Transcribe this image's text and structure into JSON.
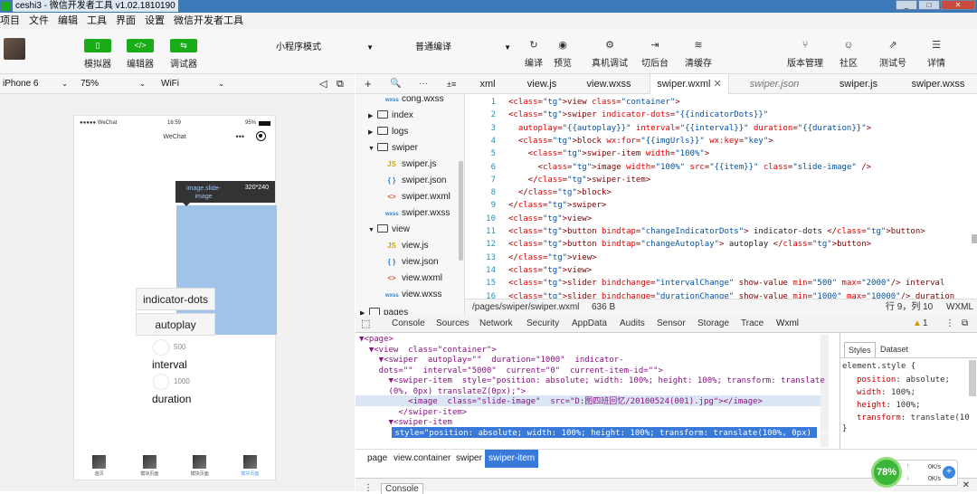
{
  "window": {
    "title": "ceshi3 - 微信开发者工具 v1.02.1810190",
    "buttons": [
      "_",
      "□",
      "✕"
    ]
  },
  "menu": [
    "项目",
    "文件",
    "编辑",
    "工具",
    "界面",
    "设置",
    "微信开发者工具"
  ],
  "toolbar": {
    "left": [
      {
        "label": "模拟器",
        "glyph": "▯"
      },
      {
        "label": "编辑器",
        "glyph": "</>"
      },
      {
        "label": "调试器",
        "glyph": "⇆"
      }
    ],
    "mode_select": "小程序模式",
    "compile_select": "普通编译",
    "mid": [
      {
        "label": "编译",
        "glyph": "↻"
      },
      {
        "label": "预览",
        "glyph": "◉"
      },
      {
        "label": "真机调试",
        "glyph": "⚙"
      },
      {
        "label": "切后台",
        "glyph": "⇥"
      },
      {
        "label": "清缓存",
        "glyph": "≋"
      }
    ],
    "right": [
      {
        "label": "版本管理",
        "glyph": "⑂"
      },
      {
        "label": "社区",
        "glyph": "☺"
      },
      {
        "label": "测试号",
        "glyph": "⇗"
      },
      {
        "label": "详情",
        "glyph": "☰"
      }
    ]
  },
  "device_bar": {
    "device": "iPhone 6",
    "zoom": "75%",
    "network": "WiFi"
  },
  "phone": {
    "status_left": "●●●●● WeChat",
    "time": "16:59",
    "battery": "95%",
    "nav_title": "WeChat",
    "nav_dots": "•••",
    "tooltip_name": "image.slide-image",
    "tooltip_dim": "320*240",
    "btn_indicator": "indicator-dots",
    "btn_autoplay": "autoplay",
    "slider1_value": "500",
    "slider1_label": "interval",
    "slider2_value": "1000",
    "slider2_label": "duration",
    "tabs": [
      {
        "label": "首页",
        "active": false
      },
      {
        "label": "模块页面",
        "active": false
      },
      {
        "label": "模块页面",
        "active": false
      },
      {
        "label": "模块页面",
        "active": true
      }
    ]
  },
  "tree": {
    "toolbar": [
      "+",
      "🔍",
      "···",
      "±≡"
    ],
    "items": [
      {
        "label": "cong.wxss",
        "type": "wxss",
        "depth": 2
      },
      {
        "label": "index",
        "type": "folder",
        "depth": 1,
        "open": false
      },
      {
        "label": "logs",
        "type": "folder",
        "depth": 1,
        "open": false
      },
      {
        "label": "swiper",
        "type": "folder",
        "depth": 1,
        "open": true
      },
      {
        "label": "swiper.js",
        "type": "js",
        "depth": 2
      },
      {
        "label": "swiper.json",
        "type": "json",
        "depth": 2
      },
      {
        "label": "swiper.wxml",
        "type": "wxml",
        "depth": 2,
        "selected": true
      },
      {
        "label": "swiper.wxss",
        "type": "wxss",
        "depth": 2
      },
      {
        "label": "view",
        "type": "folder",
        "depth": 1,
        "open": true
      },
      {
        "label": "view.js",
        "type": "js",
        "depth": 2
      },
      {
        "label": "view.json",
        "type": "json",
        "depth": 2
      },
      {
        "label": "view.wxml",
        "type": "wxml",
        "depth": 2
      },
      {
        "label": "view.wxss",
        "type": "wxss",
        "depth": 2
      },
      {
        "label": "pages",
        "type": "folder",
        "depth": 0,
        "open": false
      }
    ]
  },
  "editor_tabs": [
    {
      "label": "xml",
      "active": false,
      "italic": false
    },
    {
      "label": "view.js",
      "active": false,
      "italic": false
    },
    {
      "label": "view.wxss",
      "active": false,
      "italic": false
    },
    {
      "label": "swiper.wxml",
      "active": true,
      "italic": false
    },
    {
      "label": "swiper.json",
      "active": false,
      "italic": true
    },
    {
      "label": "swiper.js",
      "active": false,
      "italic": false
    },
    {
      "label": "swiper.wxss",
      "active": false,
      "italic": false
    }
  ],
  "code": [
    "<view class=\"container\">",
    "<swiper indicator-dots=\"{{indicatorDots}}\"",
    "  autoplay=\"{{autoplay}}\" interval=\"{{interval}}\" duration=\"{{duration}}\">",
    "  <block wx:for=\"{{imgUrls}}\" wx:key=\"key\">",
    "    <swiper-item width=\"100%\">",
    "      <image width=\"100%\" src=\"{{item}}\" class=\"slide-image\" />",
    "    </swiper-item>",
    "  </block>",
    "</swiper>",
    "<view>",
    "<button bindtap=\"changeIndicatorDots\"> indicator-dots </button>",
    "<button bindtap=\"changeAutoplay\"> autoplay </button>",
    "</view>",
    "<view>",
    "<slider bindchange=\"intervalChange\" show-value min=\"500\" max=\"2000\"/> interval",
    "<slider bindchange=\"durationChange\" show-value min=\"1000\" max=\"10000\"/> duration"
  ],
  "editor_status": {
    "path": "/pages/swiper/swiper.wxml",
    "size": "636 B",
    "position": "行 9，列 10",
    "lang": "WXML"
  },
  "devtools_tabs": [
    "Console",
    "Sources",
    "Network",
    "Security",
    "AppData",
    "Audits",
    "Sensor",
    "Storage",
    "Trace",
    "Wxml"
  ],
  "devtools_active": "Wxml",
  "warn_count": "1",
  "dom_lines": [
    "▼<page>",
    "  ▼<view  class=\"container\">",
    "    ▼<swiper  autoplay=\"\"  duration=\"1000\"  indicator-",
    "    dots=\"\"  interval=\"5000\"  current=\"0\"  current-item-id=\"\">",
    "      ▼<swiper-item  style=\"position: absolute; width: 100%; height: 100%; transform: translate",
    "      (0%, 0px) translateZ(0px);\">",
    "          <image  class=\"slide-image\"  src=\"D:图四班回忆/20100524(001).jpg\"></image>",
    "        </swiper-item>",
    "      ▼<swiper-item",
    "        style=\"position: absolute; width: 100%; height: 100%; transform: translate(100%, 0px) tra"
  ],
  "styles": {
    "tabs": [
      "Styles",
      "Dataset"
    ],
    "selector": "element.style {",
    "props": [
      {
        "k": "position",
        "v": "absolute;"
      },
      {
        "k": "width",
        "v": "100%;"
      },
      {
        "k": "height",
        "v": "100%;"
      },
      {
        "k": "transform",
        "v": "translate(10"
      }
    ],
    "close": "}"
  },
  "crumbs": [
    {
      "label": "page",
      "active": false
    },
    {
      "label": "view.container",
      "active": false
    },
    {
      "label": "swiper",
      "active": false
    },
    {
      "label": "swiper-item",
      "active": true
    }
  ],
  "console_tab": "Console",
  "widget": {
    "percent": "78%",
    "up": "0K/s",
    "down": "0K/s"
  }
}
